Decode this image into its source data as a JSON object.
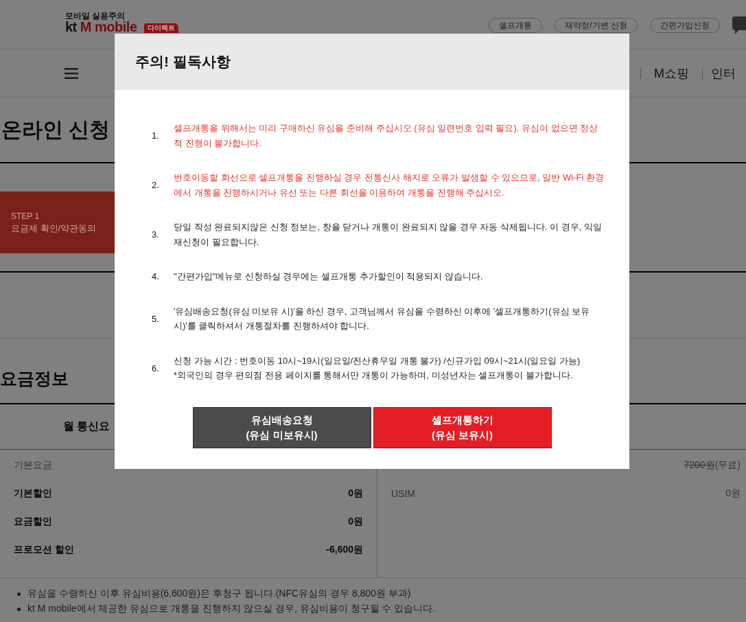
{
  "header": {
    "tagline": "모바일 실용주의",
    "logo_mark": "kt",
    "logo_name": "M mobile",
    "logo_badge": "다이렉트",
    "links": [
      "셀프개통",
      "재약정/기변 신청",
      "간편가입신청"
    ]
  },
  "nav": {
    "items": [
      "M쇼핑",
      "인터"
    ]
  },
  "page": {
    "title": "온라인 신청",
    "steps": [
      {
        "label": "STEP 1",
        "name": "요금제 확인/약관동의",
        "selected": true
      }
    ]
  },
  "fee_info": {
    "title": "요금정보",
    "column_header": "월 통신요",
    "left_rows": [
      {
        "label": "기본요금",
        "kind": "charge"
      },
      {
        "label": "기본할인",
        "value": "0원",
        "kind": "discount"
      },
      {
        "label": "요금할인",
        "value": "0원",
        "kind": "discount"
      },
      {
        "label": "프로모션 할인",
        "value": "-6,600원",
        "kind": "discount"
      }
    ],
    "right_rows": [
      {
        "value": "7200원",
        "struck": true,
        "note": "(무료)"
      },
      {
        "label": "USIM",
        "value": "0원",
        "struck": false
      }
    ],
    "notes": [
      "유심을 수령하신 이후 유심비용(6,600원)은 후청구 됩니다.(NFC유심의 경우 8,800원 부과)",
      "kt M mobile에서 제공한 유심으로 개통을 진행하지 않으실 경우, 유심비용이 청구될 수 있습니다."
    ]
  },
  "modal": {
    "title": "주의! 필독사항",
    "items": [
      {
        "number": "1.",
        "text": "셀프개통을 위해서는 미리 구매하신 유심을 준비해 주십시오 (유심 일련번호 입력 필요). 유심이 없으면 정상적 진행이 불가합니다.",
        "warning": true
      },
      {
        "number": "2.",
        "text": "번호이동할 회선으로 셀프개통을 진행하실 경우 전통신사 해지로 오류가 발생할 수 있으므로, 일반 Wi-Fi 환경에서 개통을 진행하시거나 유선 또는 다른 회선을 이용하여 개통을 진행해 주십시오.",
        "warning": true
      },
      {
        "number": "3.",
        "text": "당일 작성 완료되지않은 신청 정보는, 창을 닫거나 개통이 완료되지 않을 경우 자동 삭제됩니다. 이 경우, 익일 재신청이 필요합니다.",
        "warning": false
      },
      {
        "number": "4.",
        "text": "\"간편가입\"메뉴로 신청하실 경우에는 셀프개통 추가할인이 적용되지 않습니다.",
        "warning": false
      },
      {
        "number": "5.",
        "text": "'유심배송요청(유심 미보유 시)'을 하신 경우, 고객님께서 유심을 수령하신 이후에 '셀프개통하기(유심 보유 시)'를 클릭하셔서 개통절차를 진행하셔야 합니다.",
        "warning": false
      },
      {
        "number": "6.",
        "text": "신청 가능 시간 : 번호이동 10시~19시(일요일/전산휴무일 개통 불가) /신규가입 09시~21시(일요일 가능)\n*외국인의 경우 편의점 전용 페이지를 통해서만 개통이 가능하며, 미성년자는 셀프개통이 불가합니다.",
        "warning": false
      }
    ],
    "buttons": [
      {
        "label": "유심배송요청",
        "sub": "(유심 미보유시)",
        "kind": "secondary"
      },
      {
        "label": "셀프개통하기",
        "sub": "(유심 보유시)",
        "kind": "primary"
      }
    ]
  }
}
